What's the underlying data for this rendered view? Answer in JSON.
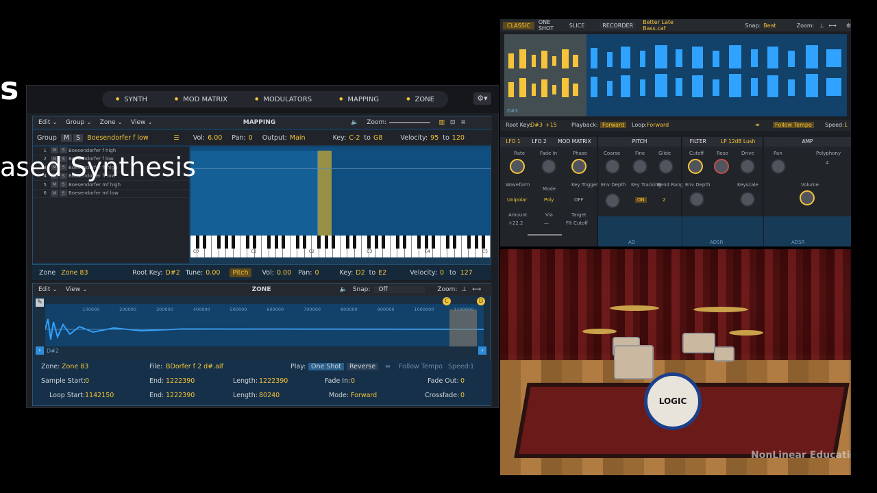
{
  "slide": {
    "letter": "s",
    "subtitle": "ased Synthesis"
  },
  "sampler": {
    "tabs": [
      "SYNTH",
      "MOD MATRIX",
      "MODULATORS",
      "MAPPING",
      "ZONE"
    ],
    "mapping": {
      "menus": [
        "Edit ⌄",
        "Group ⌄",
        "Zone ⌄",
        "View ⌄"
      ],
      "title": "MAPPING",
      "zoom_label": "Zoom:",
      "group": {
        "label": "Group",
        "name": "Boesendorfer f low",
        "vol_label": "Vol:",
        "vol": "6.00",
        "pan_label": "Pan:",
        "pan": "0",
        "output_label": "Output:",
        "output": "Main",
        "key_label": "Key:",
        "key_low": "C-2",
        "to1": "to",
        "key_high": "G8",
        "vel_label": "Velocity:",
        "vel_low": "95",
        "to2": "to",
        "vel_high": "120"
      },
      "rows": [
        {
          "n": "1",
          "name": "Boesendorfer f high"
        },
        {
          "n": "2",
          "name": "Boesendorfer f low"
        },
        {
          "n": "3",
          "name": "Boesendorfer ff high"
        },
        {
          "n": "4",
          "name": "Boesendorfer ff low"
        },
        {
          "n": "5",
          "name": "Boesendorfer mf high"
        },
        {
          "n": "6",
          "name": "Boesendorfer mf low"
        }
      ],
      "key_labels": [
        "C0",
        "C1",
        "C2",
        "C3",
        "C4",
        "C5"
      ]
    },
    "zonebar": {
      "zone_label": "Zone",
      "zone": "Zone 83",
      "root_label": "Root Key:",
      "root": "D#2",
      "tune_label": "Tune:",
      "tune": "0.00",
      "pitch": "Pitch",
      "vol_label": "Vol:",
      "vol": "0.00",
      "pan_label": "Pan:",
      "pan": "0",
      "key_label": "Key:",
      "key_low": "D2",
      "to1": "to",
      "key_high": "E2",
      "vel_label": "Velocity:",
      "vel_low": "0",
      "to2": "to",
      "vel_high": "127"
    },
    "zone": {
      "menus": [
        "Edit ⌄",
        "View ⌄"
      ],
      "title": "ZONE",
      "snap_label": "Snap:",
      "snap": "Off",
      "zoom_label": "Zoom:",
      "ruler": [
        "100000",
        "200000",
        "300000",
        "400000",
        "500000",
        "600000",
        "700000",
        "800000",
        "900000",
        "1000000",
        "1100000"
      ],
      "note": "D#2",
      "fields": {
        "zone_label": "Zone:",
        "zone": "Zone 83",
        "file_label": "File:",
        "file": "BDorfer f 2 d#.aif",
        "play_label": "Play:",
        "oneshot": "One Shot",
        "reverse": "Reverse",
        "follow": "Follow Tempo",
        "speed_label": "Speed:",
        "speed": "1",
        "ss_label": "Sample Start:",
        "ss": "0",
        "end_label": "End:",
        "end": "1222390",
        "len_label": "Length:",
        "len": "1222390",
        "fadein_label": "Fade In:",
        "fadein": "0",
        "fadeout_label": "Fade Out:",
        "fadeout": "0",
        "ls_label": "Loop Start:",
        "ls": "1142150",
        "end2_label": "End:",
        "end2": "1222390",
        "len2_label": "Length:",
        "len2": "80240",
        "mode_label": "Mode:",
        "mode": "Forward",
        "xfade_label": "Crossfade:",
        "xfade": "0"
      }
    }
  },
  "plugin": {
    "modes": [
      "CLASSIC",
      "ONE SHOT",
      "SLICE"
    ],
    "recorder": "RECORDER",
    "file": "Better Late Bass.caf",
    "snap_label": "Snap:",
    "snap": "Beat",
    "zoom_label": "Zoom:",
    "note": "D#3",
    "root_label": "Root Key:",
    "root": "D#3",
    "cents": "+15",
    "playback_label": "Playback:",
    "playback": "Forward",
    "loop_label": "Loop:",
    "loop": "Forward",
    "follow": "Follow Tempo",
    "speed_label": "Speed:",
    "speed": "1",
    "lfo_tabs": [
      "LFO 1",
      "LFO 2",
      "MOD MATRIX"
    ],
    "lfo": {
      "rate": "Rate",
      "fadein": "Fade In",
      "phase": "Phase",
      "waveform": "Waveform",
      "unipolar": "Unipolar",
      "mode": "Mode",
      "poly": "Poly",
      "keytrig": "Key Trigger",
      "off": "OFF",
      "amount": "Amount",
      "amount_val": "+22.2",
      "via": "Via",
      "via_val": "—",
      "target": "Target",
      "target_val": "Flt Cutoff"
    },
    "pitch": {
      "title": "PITCH",
      "coarse": "Coarse",
      "fine": "Fine",
      "glide": "Glide",
      "envdepth": "Env Depth",
      "keytrack": "Key Tracking",
      "on": "ON",
      "bend": "Bend Range",
      "bend_val": "2"
    },
    "filter": {
      "title": "FILTER",
      "type": "LP 12dB Lush",
      "cutoff": "Cutoff",
      "reso": "Reso",
      "drive": "Drive",
      "envdepth": "Env Depth",
      "keyscale": "Keyscale"
    },
    "amp": {
      "title": "AMP",
      "pan": "Pan",
      "polyphony": "Polyphony",
      "poly_val": "4",
      "volume": "Volume"
    },
    "env_labels": {
      "ad": "AD",
      "adsr1": "ADSR",
      "adsr2": "ADSR"
    }
  },
  "drumkit": {
    "logo_text": "LOGIC",
    "watermark": "NonLinear Educating Inc."
  }
}
